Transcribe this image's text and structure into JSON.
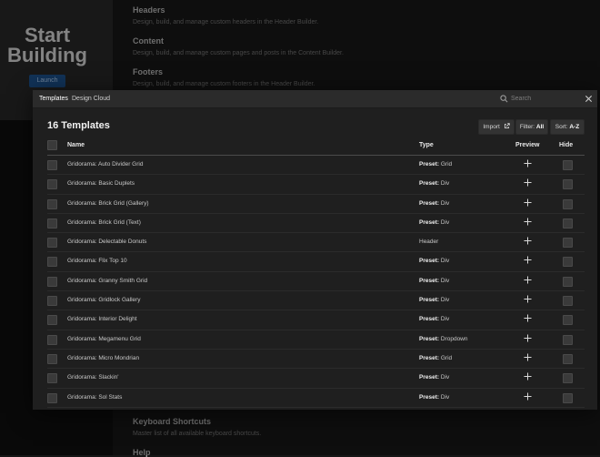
{
  "background": {
    "hero_title": "Start Building",
    "hero_button": "Launch",
    "sections": [
      {
        "title": "Headers",
        "desc": "Design, build, and manage custom headers in the Header Builder."
      },
      {
        "title": "Content",
        "desc": "Design, build, and manage custom pages and posts in the Content Builder."
      },
      {
        "title": "Footers",
        "desc": "Design, build, and manage custom footers in the Header Builder."
      }
    ],
    "bottom_sections": [
      {
        "title": "Keyboard Shortcuts",
        "desc": "Master list of all available keyboard shortcuts."
      },
      {
        "title": "Help",
        "desc": ""
      }
    ]
  },
  "modal": {
    "tabs": [
      "Templates",
      "Design Cloud"
    ],
    "search_placeholder": "Search",
    "title": "16 Templates",
    "import_label": "Import",
    "filter_label": "Filter:",
    "filter_value": "All",
    "sort_label": "Sort:",
    "sort_value": "A-Z",
    "columns": {
      "name": "Name",
      "type": "Type",
      "preview": "Preview",
      "hide": "Hide"
    },
    "rows": [
      {
        "name": "Gridorama: Auto Divider Grid",
        "type_prefix": "Preset:",
        "type": "Grid"
      },
      {
        "name": "Gridorama: Basic Duplets",
        "type_prefix": "Preset:",
        "type": "Div"
      },
      {
        "name": "Gridorama: Brick Grid (Gallery)",
        "type_prefix": "Preset:",
        "type": "Div"
      },
      {
        "name": "Gridorama: Brick Grid (Text)",
        "type_prefix": "Preset:",
        "type": "Div"
      },
      {
        "name": "Gridorama: Delectable Donuts",
        "type_prefix": "",
        "type": "Header"
      },
      {
        "name": "Gridorama: Flix Top 10",
        "type_prefix": "Preset:",
        "type": "Div"
      },
      {
        "name": "Gridorama: Granny Smith Grid",
        "type_prefix": "Preset:",
        "type": "Div"
      },
      {
        "name": "Gridorama: Gridlock Gallery",
        "type_prefix": "Preset:",
        "type": "Div"
      },
      {
        "name": "Gridorama: Interior Delight",
        "type_prefix": "Preset:",
        "type": "Div"
      },
      {
        "name": "Gridorama: Megamenu Grid",
        "type_prefix": "Preset:",
        "type": "Dropdown"
      },
      {
        "name": "Gridorama: Micro Mondrian",
        "type_prefix": "Preset:",
        "type": "Grid"
      },
      {
        "name": "Gridorama: Slackin'",
        "type_prefix": "Preset:",
        "type": "Div"
      },
      {
        "name": "Gridorama: Sol Stats",
        "type_prefix": "Preset:",
        "type": "Div"
      },
      {
        "name": "Gridorama: Sweet Grid",
        "type_prefix": "Preset:",
        "type": "Grid"
      }
    ]
  }
}
